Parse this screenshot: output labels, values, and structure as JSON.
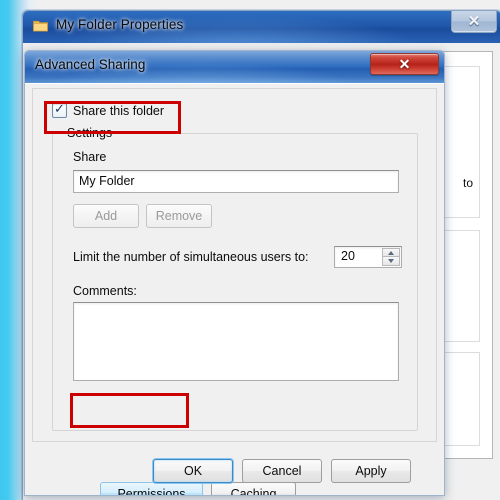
{
  "outer_window": {
    "title": "My Folder Properties",
    "folder_icon": "folder-icon",
    "close_icon": "close-icon",
    "close_glyph": "✕",
    "background_text": "to"
  },
  "dialog": {
    "title": "Advanced Sharing",
    "close_icon": "close-icon",
    "close_glyph": "✕",
    "share_checkbox": {
      "label": "Share this folder",
      "checked": true,
      "check_glyph": "✓"
    },
    "settings_group": {
      "legend": "Settings",
      "share_label": "Share",
      "share_name_value": "My Folder",
      "share_name_placeholder": "",
      "add_label": "Add",
      "remove_label": "Remove",
      "limit_label": "Limit the number of simultaneous users to:",
      "limit_value": "20",
      "spin_up_icon": "chevron-up-icon",
      "spin_down_icon": "chevron-down-icon",
      "comments_label": "Comments:",
      "comments_value": "",
      "permissions_label": "Permissions",
      "caching_label": "Caching"
    },
    "footer": {
      "ok_label": "OK",
      "cancel_label": "Cancel",
      "apply_label": "Apply"
    }
  },
  "annotations": {
    "color": "#cc0000",
    "highlighted": [
      "Share this folder",
      "Permissions"
    ]
  },
  "colors": {
    "desktop": "#3ec8f0",
    "window_chrome": "#f0f0f0",
    "titlebar_blue": "#255fb3",
    "close_red": "#b5231a",
    "annotation_red": "#cc0000",
    "highlight_blue": "#b9e3fa"
  }
}
